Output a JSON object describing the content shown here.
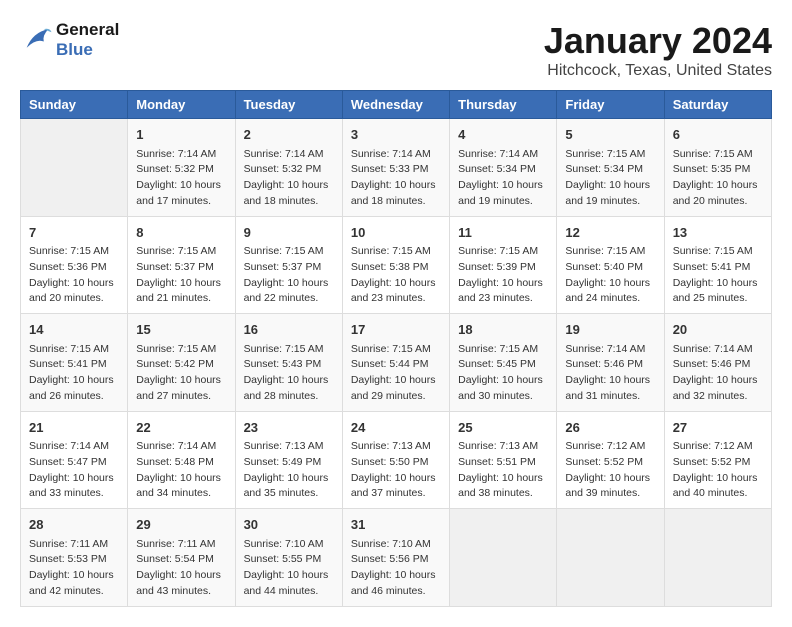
{
  "logo": {
    "line1": "General",
    "line2": "Blue"
  },
  "title": "January 2024",
  "subtitle": "Hitchcock, Texas, United States",
  "weekdays": [
    "Sunday",
    "Monday",
    "Tuesday",
    "Wednesday",
    "Thursday",
    "Friday",
    "Saturday"
  ],
  "weeks": [
    [
      {
        "day": "",
        "info": ""
      },
      {
        "day": "1",
        "info": "Sunrise: 7:14 AM\nSunset: 5:32 PM\nDaylight: 10 hours\nand 17 minutes."
      },
      {
        "day": "2",
        "info": "Sunrise: 7:14 AM\nSunset: 5:32 PM\nDaylight: 10 hours\nand 18 minutes."
      },
      {
        "day": "3",
        "info": "Sunrise: 7:14 AM\nSunset: 5:33 PM\nDaylight: 10 hours\nand 18 minutes."
      },
      {
        "day": "4",
        "info": "Sunrise: 7:14 AM\nSunset: 5:34 PM\nDaylight: 10 hours\nand 19 minutes."
      },
      {
        "day": "5",
        "info": "Sunrise: 7:15 AM\nSunset: 5:34 PM\nDaylight: 10 hours\nand 19 minutes."
      },
      {
        "day": "6",
        "info": "Sunrise: 7:15 AM\nSunset: 5:35 PM\nDaylight: 10 hours\nand 20 minutes."
      }
    ],
    [
      {
        "day": "7",
        "info": "Sunrise: 7:15 AM\nSunset: 5:36 PM\nDaylight: 10 hours\nand 20 minutes."
      },
      {
        "day": "8",
        "info": "Sunrise: 7:15 AM\nSunset: 5:37 PM\nDaylight: 10 hours\nand 21 minutes."
      },
      {
        "day": "9",
        "info": "Sunrise: 7:15 AM\nSunset: 5:37 PM\nDaylight: 10 hours\nand 22 minutes."
      },
      {
        "day": "10",
        "info": "Sunrise: 7:15 AM\nSunset: 5:38 PM\nDaylight: 10 hours\nand 23 minutes."
      },
      {
        "day": "11",
        "info": "Sunrise: 7:15 AM\nSunset: 5:39 PM\nDaylight: 10 hours\nand 23 minutes."
      },
      {
        "day": "12",
        "info": "Sunrise: 7:15 AM\nSunset: 5:40 PM\nDaylight: 10 hours\nand 24 minutes."
      },
      {
        "day": "13",
        "info": "Sunrise: 7:15 AM\nSunset: 5:41 PM\nDaylight: 10 hours\nand 25 minutes."
      }
    ],
    [
      {
        "day": "14",
        "info": "Sunrise: 7:15 AM\nSunset: 5:41 PM\nDaylight: 10 hours\nand 26 minutes."
      },
      {
        "day": "15",
        "info": "Sunrise: 7:15 AM\nSunset: 5:42 PM\nDaylight: 10 hours\nand 27 minutes."
      },
      {
        "day": "16",
        "info": "Sunrise: 7:15 AM\nSunset: 5:43 PM\nDaylight: 10 hours\nand 28 minutes."
      },
      {
        "day": "17",
        "info": "Sunrise: 7:15 AM\nSunset: 5:44 PM\nDaylight: 10 hours\nand 29 minutes."
      },
      {
        "day": "18",
        "info": "Sunrise: 7:15 AM\nSunset: 5:45 PM\nDaylight: 10 hours\nand 30 minutes."
      },
      {
        "day": "19",
        "info": "Sunrise: 7:14 AM\nSunset: 5:46 PM\nDaylight: 10 hours\nand 31 minutes."
      },
      {
        "day": "20",
        "info": "Sunrise: 7:14 AM\nSunset: 5:46 PM\nDaylight: 10 hours\nand 32 minutes."
      }
    ],
    [
      {
        "day": "21",
        "info": "Sunrise: 7:14 AM\nSunset: 5:47 PM\nDaylight: 10 hours\nand 33 minutes."
      },
      {
        "day": "22",
        "info": "Sunrise: 7:14 AM\nSunset: 5:48 PM\nDaylight: 10 hours\nand 34 minutes."
      },
      {
        "day": "23",
        "info": "Sunrise: 7:13 AM\nSunset: 5:49 PM\nDaylight: 10 hours\nand 35 minutes."
      },
      {
        "day": "24",
        "info": "Sunrise: 7:13 AM\nSunset: 5:50 PM\nDaylight: 10 hours\nand 37 minutes."
      },
      {
        "day": "25",
        "info": "Sunrise: 7:13 AM\nSunset: 5:51 PM\nDaylight: 10 hours\nand 38 minutes."
      },
      {
        "day": "26",
        "info": "Sunrise: 7:12 AM\nSunset: 5:52 PM\nDaylight: 10 hours\nand 39 minutes."
      },
      {
        "day": "27",
        "info": "Sunrise: 7:12 AM\nSunset: 5:52 PM\nDaylight: 10 hours\nand 40 minutes."
      }
    ],
    [
      {
        "day": "28",
        "info": "Sunrise: 7:11 AM\nSunset: 5:53 PM\nDaylight: 10 hours\nand 42 minutes."
      },
      {
        "day": "29",
        "info": "Sunrise: 7:11 AM\nSunset: 5:54 PM\nDaylight: 10 hours\nand 43 minutes."
      },
      {
        "day": "30",
        "info": "Sunrise: 7:10 AM\nSunset: 5:55 PM\nDaylight: 10 hours\nand 44 minutes."
      },
      {
        "day": "31",
        "info": "Sunrise: 7:10 AM\nSunset: 5:56 PM\nDaylight: 10 hours\nand 46 minutes."
      },
      {
        "day": "",
        "info": ""
      },
      {
        "day": "",
        "info": ""
      },
      {
        "day": "",
        "info": ""
      }
    ]
  ]
}
